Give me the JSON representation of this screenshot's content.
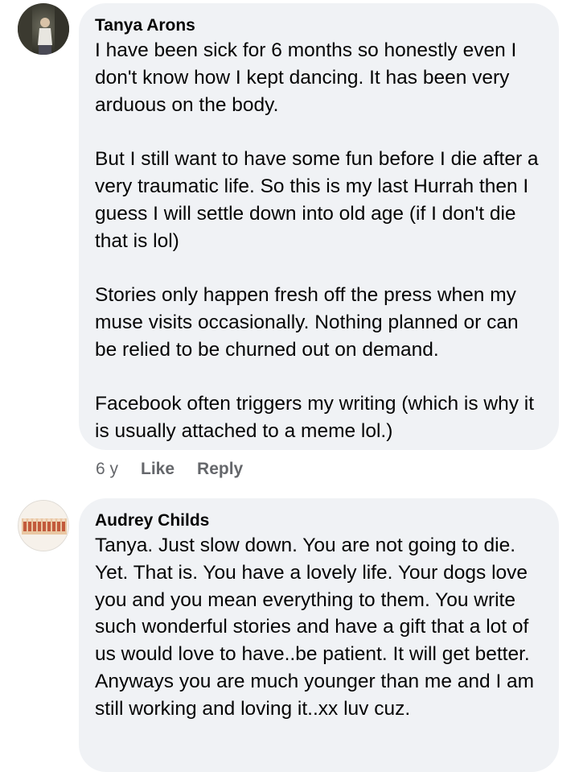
{
  "comments": [
    {
      "author": "Tanya Arons",
      "paragraphs": [
        "I have been sick for 6 months so honestly even I don't know how I kept dancing. It has been very arduous on the body.",
        "But I still want to have some fun before I die after a very traumatic life.  So this is my last Hurrah then I guess I will settle down into old age (if I don't die that is lol)",
        "Stories only happen fresh off the press when my muse visits occasionally.  Nothing planned or can be relied to be churned out on demand.",
        "Facebook often triggers my writing (which is why it is usually attached to a meme lol.)"
      ],
      "time": "6 y",
      "like_label": "Like",
      "reply_label": "Reply",
      "avatar_icon": "profile-photo-icon"
    },
    {
      "author": "Audrey Childs",
      "paragraphs": [
        "Tanya.  Just slow down. You are not going to die. Yet.  That is. You have a lovely life. Your dogs love you and you mean everything to them. You write such wonderful stories and have a gift that a lot of us would love to have..be patient. It will get better. Anyways you are much younger than me and I am still working and loving it..xx luv cuz."
      ],
      "avatar_icon": "profile-photo-icon"
    }
  ],
  "colors": {
    "bubble_bg": "#f0f2f5",
    "text": "#050505",
    "meta_text": "#65676b"
  }
}
